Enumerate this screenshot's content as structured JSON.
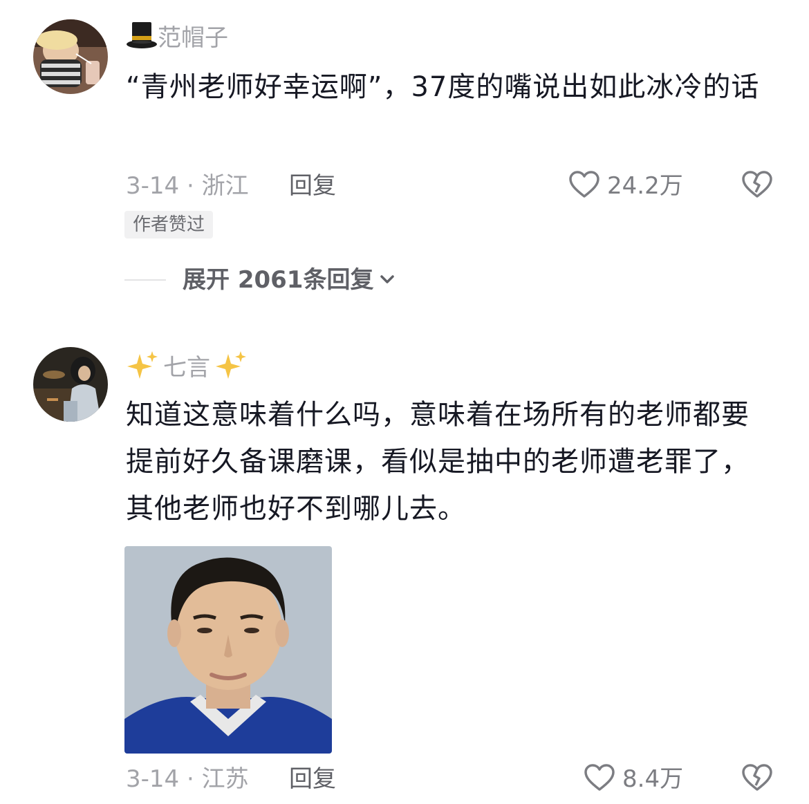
{
  "comments": [
    {
      "username": "范帽子",
      "username_prefix_icon": "top-hat-icon",
      "text": "“青州老师好幸运啊”，37度的嘴说出如此冰冷的话",
      "date_location": "3-14 · 浙江",
      "reply_label": "回复",
      "like_count": "24.2万",
      "author_tag": "作者赞过",
      "expand_label": "展开 2061条回复"
    },
    {
      "username": "七言",
      "username_prefix_icon": "sparkles-icon",
      "username_suffix_icon": "sparkles-icon",
      "text": "知道这意味着什么吗，意味着在场所有的老师都要提前好久备课磨课，看似是抽中的老师遭老罪了，其他老师也好不到哪儿去。",
      "date_location": "3-14 · 江苏",
      "reply_label": "回复",
      "like_count": "8.4万",
      "image": "portrait-photo"
    }
  ],
  "colors": {
    "text_primary": "#161823",
    "text_secondary": "#a2a3a8",
    "reply": "#5f6066",
    "tag_bg": "#f1f1f2",
    "sparkle": "#f5c445"
  }
}
